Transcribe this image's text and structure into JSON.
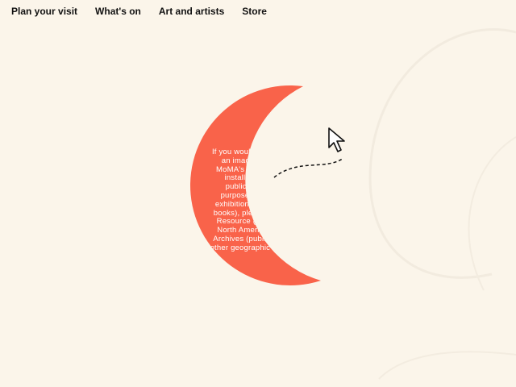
{
  "nav": {
    "items": [
      {
        "label": "Plan your visit"
      },
      {
        "label": "What's on"
      },
      {
        "label": "Art and artists"
      },
      {
        "label": "Store"
      }
    ]
  },
  "hero": {
    "moon_text": "If you would like to request an image of a work in MoMA's collection, or an installation view, for publication or other purposes (including in exhibition checklists, and books), please contact Art Resource (publication in North America) or Scala Archives (publication in all other geographic locations).",
    "moon_color": "#f9634a",
    "background_color": "#fbf5ea",
    "cursor_icon": "pointer-arrow-icon"
  }
}
